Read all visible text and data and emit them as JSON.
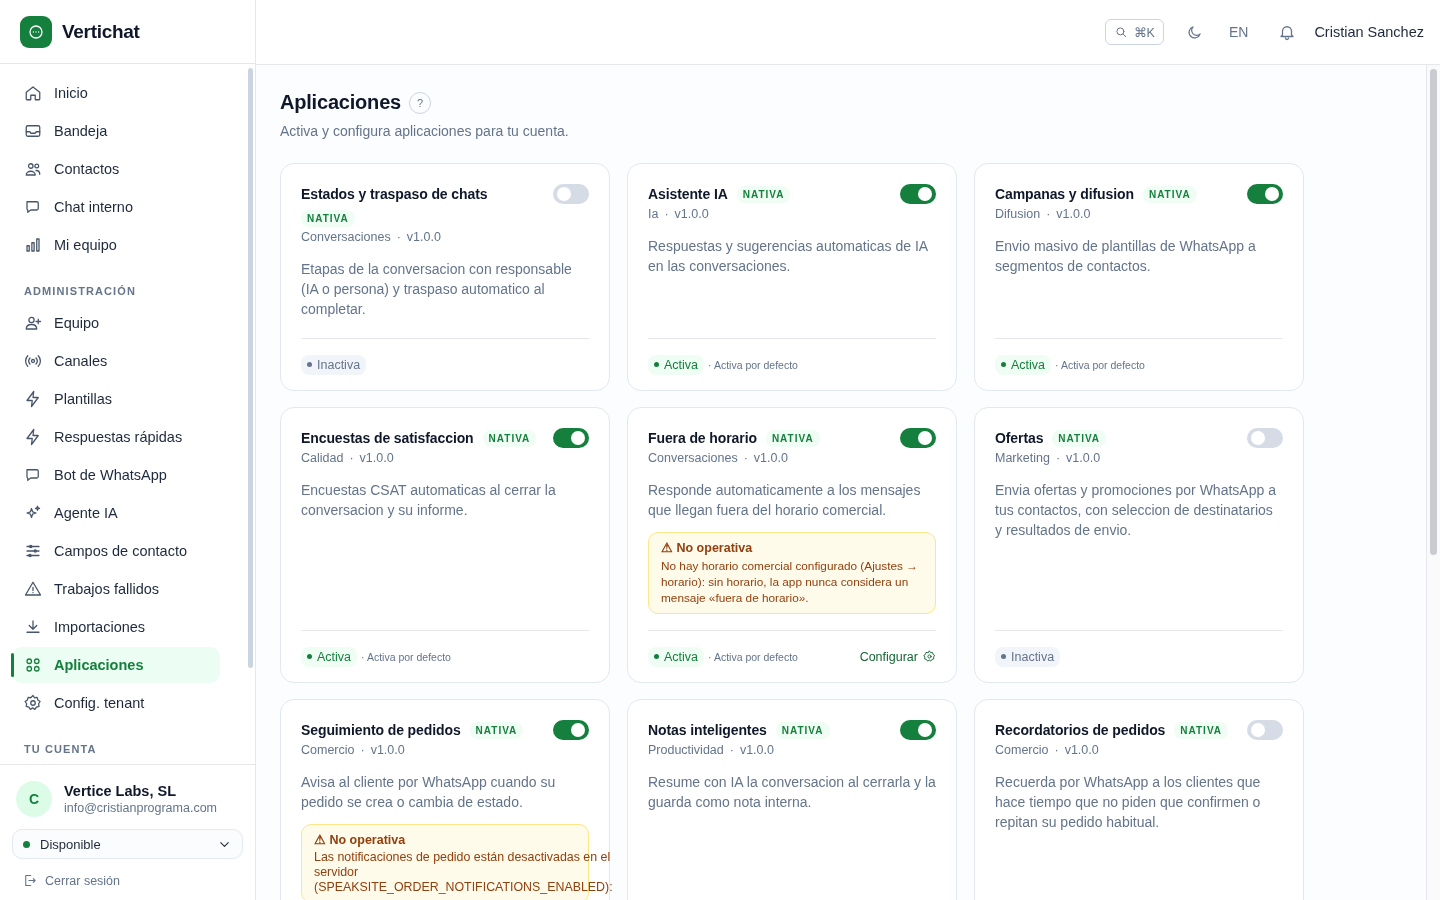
{
  "app": {
    "name": "Vertichat"
  },
  "header": {
    "search_shortcut": "⌘K",
    "language": "EN",
    "user_name": "Cristian Sanchez"
  },
  "sidebar": {
    "sections": [
      {
        "items": [
          {
            "label": "Inicio",
            "selected": false
          },
          {
            "label": "Bandeja",
            "selected": false
          },
          {
            "label": "Contactos",
            "selected": false
          },
          {
            "label": "Chat interno",
            "selected": false
          },
          {
            "label": "Mi equipo",
            "selected": false
          }
        ]
      },
      {
        "title": "ADMINISTRACIÓN",
        "items": [
          {
            "label": "Equipo",
            "selected": false
          },
          {
            "label": "Canales",
            "selected": false
          },
          {
            "label": "Plantillas",
            "selected": false
          },
          {
            "label": "Respuestas rápidas",
            "selected": false
          },
          {
            "label": "Bot de WhatsApp",
            "selected": false
          },
          {
            "label": "Agente IA",
            "selected": false
          },
          {
            "label": "Campos de contacto",
            "selected": false
          },
          {
            "label": "Trabajos fallidos",
            "selected": false
          },
          {
            "label": "Importaciones",
            "selected": false
          },
          {
            "label": "Aplicaciones",
            "selected": true
          },
          {
            "label": "Config. tenant",
            "selected": false
          }
        ]
      },
      {
        "title": "TU CUENTA"
      }
    ],
    "account": {
      "avatar": "C",
      "name": "Vertice Labs, SL",
      "email": "info@cristianprograma.com",
      "status": "Disponible"
    },
    "logout": "Cerrar sesión"
  },
  "page": {
    "title": "Aplicaciones",
    "help": "?",
    "subtitle": "Activa y configura aplicaciones para tu cuenta."
  },
  "cards": [
    {
      "title": "Estados y traspaso de chats",
      "badge": "NATIVA",
      "category": "Conversaciones",
      "separator": "·",
      "version": "v1.0.0",
      "enabled": false,
      "description": "Etapas de la conversacion con responsable (IA o persona) y traspaso automatico al completar.",
      "status": {
        "label": "Inactiva",
        "active": false
      }
    },
    {
      "title": "Asistente IA",
      "badge": "NATIVA",
      "category": "Ia",
      "separator": "·",
      "version": "v1.0.0",
      "enabled": true,
      "description": "Respuestas y sugerencias automaticas de IA en las conversaciones.",
      "status": {
        "label": "Activa",
        "active": true
      },
      "note": "· Activa por defecto"
    },
    {
      "title": "Campanas y difusion",
      "badge": "NATIVA",
      "category": "Difusion",
      "separator": "·",
      "version": "v1.0.0",
      "enabled": true,
      "description": "Envio masivo de plantillas de WhatsApp a segmentos de contactos.",
      "status": {
        "label": "Activa",
        "active": true
      },
      "note": "· Activa por defecto"
    },
    {
      "title": "Encuestas de satisfaccion",
      "badge": "NATIVA",
      "category": "Calidad",
      "separator": "·",
      "version": "v1.0.0",
      "enabled": true,
      "description": "Encuestas CSAT automaticas al cerrar la conversacion y su informe.",
      "status": {
        "label": "Activa",
        "active": true
      },
      "note": "· Activa por defecto"
    },
    {
      "title": "Fuera de horario",
      "badge": "NATIVA",
      "category": "Conversaciones",
      "separator": "·",
      "version": "v1.0.0",
      "enabled": true,
      "description": "Responde automaticamente a los mensajes que llegan fuera del horario comercial.",
      "warning": {
        "title": "⚠ No operativa",
        "text": "No hay horario comercial configurado (Ajustes → horario): sin horario, la app nunca considera un mensaje «fuera de horario»."
      },
      "status": {
        "label": "Activa",
        "active": true
      },
      "note": "· Activa por defecto",
      "action": "Configurar"
    },
    {
      "title": "Ofertas",
      "badge": "NATIVA",
      "category": "Marketing",
      "separator": "·",
      "version": "v1.0.0",
      "enabled": false,
      "description": "Envia ofertas y promociones por WhatsApp a tus contactos, con seleccion de destinatarios y resultados de envio.",
      "status": {
        "label": "Inactiva",
        "active": false
      }
    },
    {
      "title": "Seguimiento de pedidos",
      "badge": "NATIVA",
      "category": "Comercio",
      "separator": "·",
      "version": "v1.0.0",
      "enabled": true,
      "description": "Avisa al cliente por WhatsApp cuando su pedido se crea o cambia de estado.",
      "warning": {
        "title": "⚠ No operativa",
        "text": "Las notificaciones de pedido están desactivadas en el servidor (SPEAKSITE_ORDER_NOTIFICATIONS_ENABLED):"
      }
    },
    {
      "title": "Notas inteligentes",
      "badge": "NATIVA",
      "category": "Productividad",
      "separator": "·",
      "version": "v1.0.0",
      "enabled": true,
      "description": "Resume con IA la conversacion al cerrarla y la guarda como nota interna."
    },
    {
      "title": "Recordatorios de pedidos",
      "badge": "NATIVA",
      "category": "Comercio",
      "separator": "·",
      "version": "v1.0.0",
      "enabled": false,
      "description": "Recuerda por WhatsApp a los clientes que hace tiempo que no piden que confirmen o repitan su pedido habitual."
    }
  ]
}
